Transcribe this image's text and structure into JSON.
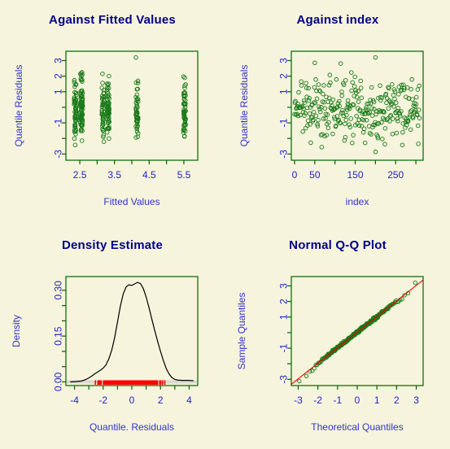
{
  "figure": {
    "background_color": "#F6F4DC",
    "panel_border_color": "#006400",
    "point_color": "#1A7A1A",
    "title_color": "#00008B",
    "axis_label_color": "#3333CC",
    "tick_label_color": "#2222CC",
    "reference_line_color": "#EE0000",
    "rug_color": "#FF0000",
    "density_line_color": "#000000",
    "layout": "2x2 grid of diagnostic plots"
  },
  "panels": [
    {
      "id": "against-fitted-values",
      "title": "Against Fitted Values",
      "xlabel": "Fitted Values",
      "ylabel": "Quantile Residuals",
      "x_ticks": [
        2.5,
        3.5,
        4.5,
        5.5
      ],
      "x_tick_labels": [
        "2.5",
        "3.5",
        "4.5",
        "5.5"
      ],
      "y_ticks": [
        -3,
        -1,
        1,
        2,
        3
      ],
      "y_tick_labels": [
        "-3",
        "-1",
        "1",
        "2",
        "3"
      ],
      "xlim": [
        2.1,
        5.9
      ],
      "ylim": [
        -3.4,
        3.6
      ],
      "grid": false
    },
    {
      "id": "against-index",
      "title": "Against  index",
      "xlabel": "index",
      "ylabel": "Quantile Residuals",
      "x_ticks": [
        0,
        50,
        150,
        250
      ],
      "x_tick_labels": [
        "0",
        "50",
        "150",
        "250"
      ],
      "y_ticks": [
        -3,
        -1,
        1,
        2,
        3
      ],
      "y_tick_labels": [
        "-3",
        "-1",
        "1",
        "2",
        "3"
      ],
      "xlim": [
        -8,
        318
      ],
      "ylim": [
        -3.4,
        3.6
      ],
      "grid": false
    },
    {
      "id": "density-estimate",
      "title": "Density Estimate",
      "xlabel": "Quantile. Residuals",
      "ylabel": "Density",
      "x_ticks": [
        -4,
        -2,
        0,
        2,
        4
      ],
      "x_tick_labels": [
        "-4",
        "-2",
        "0",
        "2",
        "4"
      ],
      "y_ticks": [
        0.0,
        0.15,
        0.3
      ],
      "y_tick_labels": [
        "0.00",
        "0.15",
        "0.30"
      ],
      "xlim": [
        -4.6,
        4.6
      ],
      "ylim": [
        -0.012,
        0.345
      ],
      "grid": false
    },
    {
      "id": "normal-qq-plot",
      "title": "Normal Q-Q Plot",
      "xlabel": "Theoretical Quantiles",
      "ylabel": "Sample Quantiles",
      "x_ticks": [
        -3,
        -2,
        -1,
        0,
        1,
        2,
        3
      ],
      "x_tick_labels": [
        "-3",
        "-2",
        "-1",
        "0",
        "1",
        "2",
        "3"
      ],
      "y_ticks": [
        -3,
        -1,
        1,
        2,
        3
      ],
      "y_tick_labels": [
        "-3",
        "-1",
        "1",
        "2",
        "3"
      ],
      "xlim": [
        -3.35,
        3.35
      ],
      "ylim": [
        -3.4,
        3.6
      ],
      "grid": false
    }
  ],
  "chart_data": [
    {
      "type": "scatter",
      "id": "against-fitted-values",
      "title": "Against Fitted Values",
      "xlabel": "Fitted Values",
      "ylabel": "Quantile Residuals",
      "xlim": [
        2.1,
        5.9
      ],
      "ylim": [
        -3.4,
        3.6
      ],
      "xticks": [
        2.5,
        3.5,
        4.5,
        5.5
      ],
      "yticks": [
        -3,
        -1,
        1,
        2,
        3
      ],
      "grid": false,
      "note": "Fitted values occur in four discrete clusters near 2.35, 2.55, 3.15, 3.3, 4.15 and 5.5; residuals spread roughly -3 to 3.2",
      "clusters": [
        {
          "x": 2.37,
          "n": 55,
          "y_min": -2.6,
          "y_max": 2.2
        },
        {
          "x": 2.55,
          "n": 80,
          "y_min": -2.95,
          "y_max": 2.25
        },
        {
          "x": 3.17,
          "n": 45,
          "y_min": -2.4,
          "y_max": 2.3
        },
        {
          "x": 3.32,
          "n": 65,
          "y_min": -2.05,
          "y_max": 2.1
        },
        {
          "x": 4.15,
          "n": 50,
          "y_min": -1.95,
          "y_max": 1.7
        },
        {
          "x": 5.52,
          "n": 55,
          "y_min": -2.0,
          "y_max": 2.0
        },
        {
          "x": 4.15,
          "n": 1,
          "y_min": 3.2,
          "y_max": 3.2
        }
      ]
    },
    {
      "type": "scatter",
      "id": "against-index",
      "title": "Against  index",
      "xlabel": "index",
      "ylabel": "Quantile Residuals",
      "xlim": [
        -8,
        318
      ],
      "ylim": [
        -3.4,
        3.6
      ],
      "xticks": [
        0,
        50,
        100,
        150,
        200,
        250,
        300
      ],
      "labeled_xticks": [
        0,
        50,
        150,
        250
      ],
      "yticks": [
        -3,
        -1,
        1,
        2,
        3
      ],
      "grid": false,
      "n_points": 310,
      "note": "Unstructured cloud of quantile residuals versus observation index, centred near 0 with range about -3 to 3.2"
    },
    {
      "type": "line",
      "id": "density-estimate",
      "title": "Density Estimate",
      "xlabel": "Quantile. Residuals",
      "ylabel": "Density",
      "xlim": [
        -4.6,
        4.6
      ],
      "ylim": [
        -0.012,
        0.345
      ],
      "xticks": [
        -4,
        -2,
        0,
        2,
        4
      ],
      "yticks": [
        0.0,
        0.15,
        0.3
      ],
      "grid": false,
      "x": [
        -4.3,
        -3.9,
        -3.5,
        -3.2,
        -3.0,
        -2.8,
        -2.6,
        -2.4,
        -2.2,
        -2.0,
        -1.8,
        -1.6,
        -1.4,
        -1.2,
        -1.0,
        -0.8,
        -0.6,
        -0.4,
        -0.2,
        0.0,
        0.2,
        0.4,
        0.6,
        0.8,
        1.0,
        1.2,
        1.4,
        1.6,
        1.8,
        2.0,
        2.2,
        2.4,
        2.6,
        2.8,
        3.0,
        3.2,
        3.5,
        3.9,
        4.3
      ],
      "y": [
        0.0,
        0.001,
        0.003,
        0.008,
        0.013,
        0.019,
        0.026,
        0.032,
        0.038,
        0.045,
        0.056,
        0.076,
        0.104,
        0.145,
        0.196,
        0.248,
        0.288,
        0.311,
        0.318,
        0.316,
        0.321,
        0.326,
        0.322,
        0.306,
        0.278,
        0.243,
        0.205,
        0.168,
        0.133,
        0.1,
        0.07,
        0.044,
        0.026,
        0.014,
        0.008,
        0.006,
        0.005,
        0.005,
        0.004
      ],
      "rug_present": true,
      "rug_range": [
        -3.0,
        3.5
      ]
    },
    {
      "type": "scatter",
      "id": "normal-qq-plot",
      "title": "Normal Q-Q Plot",
      "xlabel": "Theoretical Quantiles",
      "ylabel": "Sample Quantiles",
      "xlim": [
        -3.35,
        3.35
      ],
      "ylim": [
        -3.4,
        3.6
      ],
      "xticks": [
        -3,
        -2,
        -1,
        0,
        1,
        2,
        3
      ],
      "yticks": [
        -3,
        -1,
        1,
        2,
        3
      ],
      "grid": false,
      "n_points": 310,
      "reference_line": {
        "slope": 1.0,
        "intercept": 0.03,
        "color": "#EE0000"
      },
      "note": "Sample quantiles track the reference line closely; slight departures in the lower tail and one high outlier near (3.0, 3.2)"
    }
  ]
}
